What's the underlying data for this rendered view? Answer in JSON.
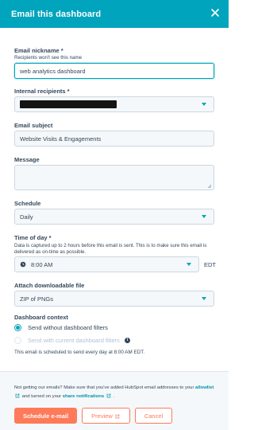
{
  "header": {
    "title": "Email this dashboard"
  },
  "nickname": {
    "label": "Email nickname *",
    "hint": "Recipients won't see this name",
    "value": "web analytics dashboard"
  },
  "recipients": {
    "label": "Internal recipients *"
  },
  "subject": {
    "label": "Email subject",
    "value": "Website Visits & Engagements"
  },
  "message": {
    "label": "Message",
    "value": ""
  },
  "schedule": {
    "label": "Schedule",
    "value": "Daily"
  },
  "time_of_day": {
    "label": "Time of day *",
    "hint": "Data is captured up to 2 hours before this email is sent. This is to make sure this email is delivered as on-time as possible.",
    "value": "8:00 AM",
    "timezone": "EDT"
  },
  "attachment": {
    "label": "Attach downloadable file",
    "value": "ZIP of PNGs"
  },
  "context": {
    "label": "Dashboard context",
    "option_without": "Send without dashboard filters",
    "option_with": "Send with current dashboard filters",
    "selected": "without"
  },
  "schedule_note": "This email is scheduled to send every day at 8:00 AM EDT.",
  "footer": {
    "text_1": "Not getting our emails? Make sure that you've added HubSpot email addresses to your ",
    "allowlist_link": "allowlist",
    "text_2": " and turned on your ",
    "notifications_link": "share notifications",
    "text_3": " ."
  },
  "buttons": {
    "schedule": "Schedule e-mail",
    "preview": "Preview",
    "cancel": "Cancel"
  },
  "colors": {
    "header": "#00a4bd",
    "primary": "#ff7a59",
    "link": "#0091ae",
    "text": "#33475b"
  }
}
